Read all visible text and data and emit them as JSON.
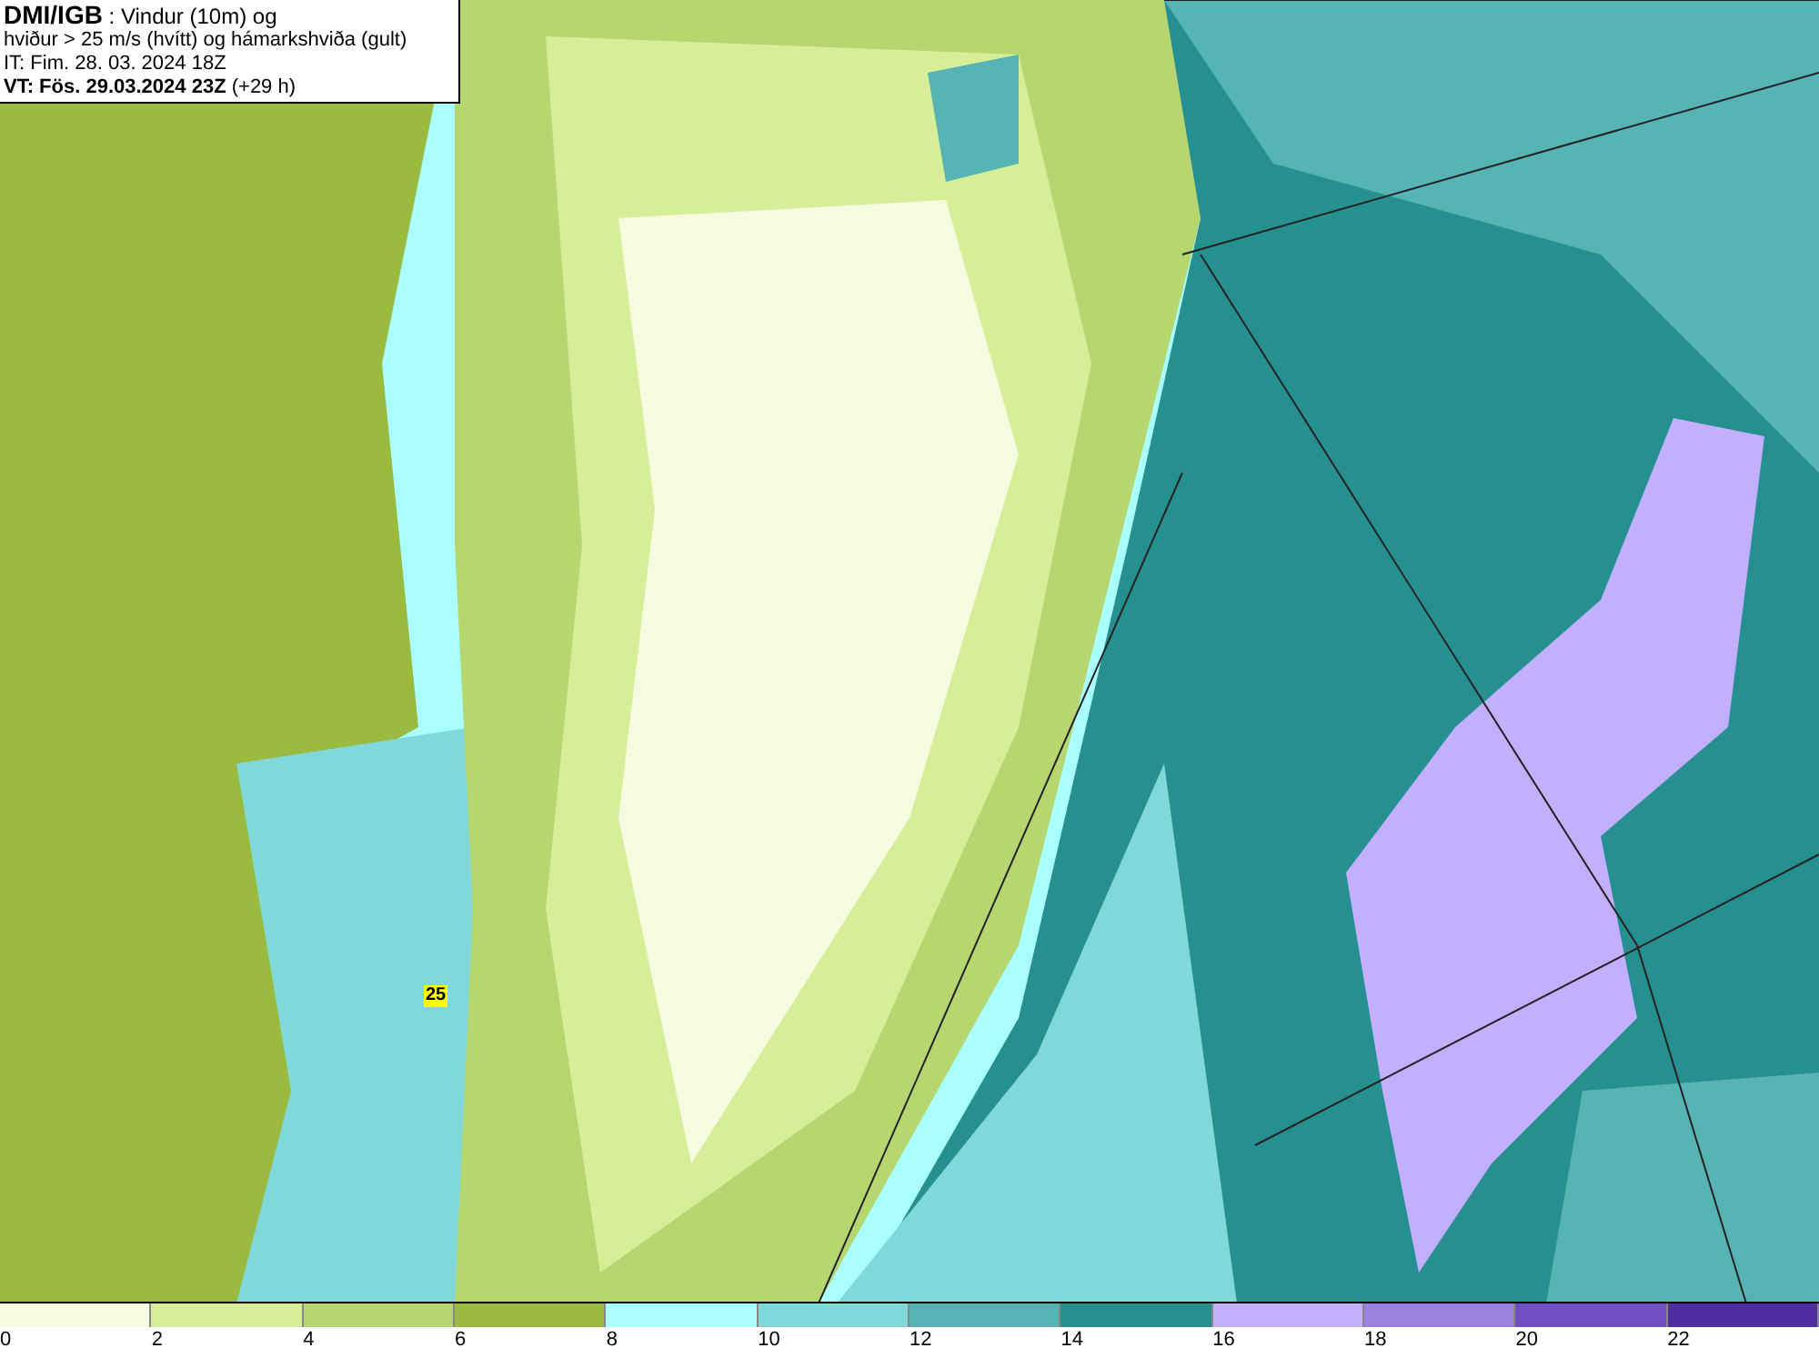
{
  "header": {
    "source": "DMI/IGB",
    "title": " : Vindur (10m) og",
    "subtitle": "hviður > 25 m/s (hvítt) og hámarkshviða (gult)",
    "issue_time": "IT: Fim. 28. 03. 2024 18Z",
    "valid_time": "VT: Fös. 29.03.2024 23Z",
    "lead": " (+29 h)"
  },
  "map": {
    "gust_label": "25"
  },
  "legend": {
    "bins": [
      {
        "color": "#f5fce0",
        "label": "0"
      },
      {
        "color": "#d6ee98",
        "label": "2"
      },
      {
        "color": "#b6d770",
        "label": "4"
      },
      {
        "color": "#9aba40",
        "label": "6"
      },
      {
        "color": "#aaffff",
        "label": "8"
      },
      {
        "color": "#80d8d8",
        "label": "10"
      },
      {
        "color": "#57b4b4",
        "label": "12"
      },
      {
        "color": "#269090",
        "label": "14"
      },
      {
        "color": "#c2b0ff",
        "label": "16"
      },
      {
        "color": "#9a82e0",
        "label": "18"
      },
      {
        "color": "#7050c4",
        "label": "20"
      },
      {
        "color": "#4e2ea0",
        "label": "22"
      }
    ]
  }
}
